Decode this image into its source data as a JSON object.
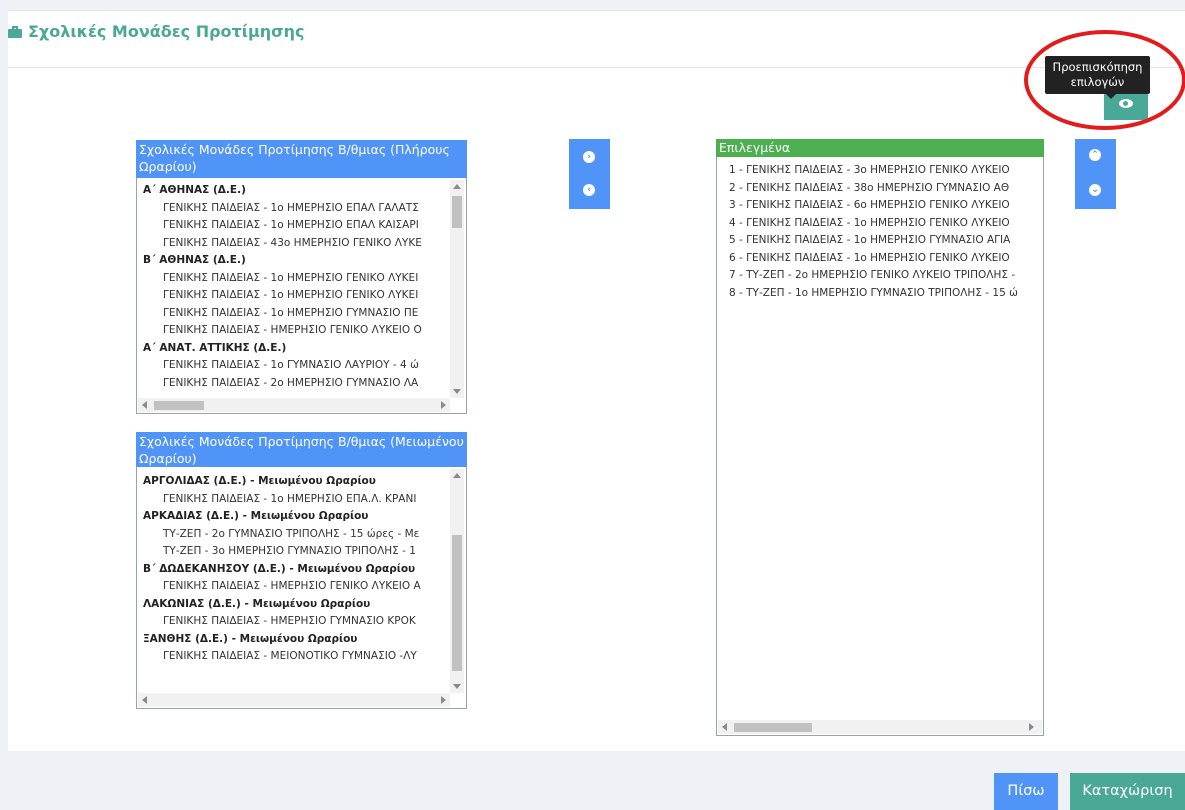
{
  "header": {
    "title": "Σχολικές Μονάδες Προτίμησης"
  },
  "full_time_list": {
    "title": "Σχολικές Μονάδες Προτίμησης Β/θμιας (Πλήρους Ωραρίου)",
    "rows": [
      {
        "type": "group",
        "text": "Α΄ ΑΘΗΝΑΣ (Δ.Ε.)"
      },
      {
        "type": "item",
        "text": "ΓΕΝΙΚΗΣ ΠΑΙΔΕΙΑΣ - 1ο ΗΜΕΡΗΣΙΟ ΕΠΑΛ ΓΑΛΑΤΣ"
      },
      {
        "type": "item",
        "text": "ΓΕΝΙΚΗΣ ΠΑΙΔΕΙΑΣ - 1ο ΗΜΕΡΗΣΙΟ ΕΠΑΛ ΚΑΙΣΑΡΙ"
      },
      {
        "type": "item",
        "text": "ΓΕΝΙΚΗΣ ΠΑΙΔΕΙΑΣ - 43ο ΗΜΕΡΗΣΙΟ ΓΕΝΙΚΟ ΛΥΚΕ"
      },
      {
        "type": "group",
        "text": "Β΄ ΑΘΗΝΑΣ (Δ.Ε.)"
      },
      {
        "type": "item",
        "text": "ΓΕΝΙΚΗΣ ΠΑΙΔΕΙΑΣ - 1ο ΗΜΕΡΗΣΙΟ ΓΕΝΙΚΟ ΛΥΚΕΙ"
      },
      {
        "type": "item",
        "text": "ΓΕΝΙΚΗΣ ΠΑΙΔΕΙΑΣ - 1ο ΗΜΕΡΗΣΙΟ ΓΕΝΙΚΟ ΛΥΚΕΙ"
      },
      {
        "type": "item",
        "text": "ΓΕΝΙΚΗΣ ΠΑΙΔΕΙΑΣ - 1ο ΗΜΕΡΗΣΙΟ ΓΥΜΝΑΣΙΟ ΠΕ"
      },
      {
        "type": "item",
        "text": "ΓΕΝΙΚΗΣ ΠΑΙΔΕΙΑΣ - ΗΜΕΡΗΣΙΟ ΓΕΝΙΚΟ ΛΥΚΕΙΟ Ο"
      },
      {
        "type": "group",
        "text": "Α΄ ΑΝΑΤ. ΑΤΤΙΚΗΣ (Δ.Ε.)"
      },
      {
        "type": "item",
        "text": "ΓΕΝΙΚΗΣ ΠΑΙΔΕΙΑΣ - 1ο ΓΥΜΝΑΣΙΟ ΛΑΥΡΙΟΥ - 4 ώ"
      },
      {
        "type": "item",
        "text": "ΓΕΝΙΚΗΣ ΠΑΙΔΕΙΑΣ - 2ο ΗΜΕΡΗΣΙΟ ΓΥΜΝΑΣΙΟ ΛΑ"
      }
    ]
  },
  "reduced_time_list": {
    "title": "Σχολικές Μονάδες Προτίμησης Β/θμιας (Μειωμένου Ωραρίου)",
    "rows": [
      {
        "type": "group",
        "text": "ΑΡΓΟΛΙΔΑΣ (Δ.Ε.) - Μειωμένου Ωραρίου"
      },
      {
        "type": "item",
        "text": "ΓΕΝΙΚΗΣ ΠΑΙΔΕΙΑΣ - 1ο ΗΜΕΡΗΣΙΟ ΕΠΑ.Λ. ΚΡΑΝΙ"
      },
      {
        "type": "group",
        "text": "ΑΡΚΑΔΙΑΣ (Δ.Ε.) - Μειωμένου Ωραρίου"
      },
      {
        "type": "item",
        "text": "ΤΥ-ΖΕΠ - 2ο ΓΥΜΝΑΣΙΟ ΤΡΙΠΟΛΗΣ - 15 ώρες - Με"
      },
      {
        "type": "item",
        "text": "ΤΥ-ΖΕΠ - 3ο ΗΜΕΡΗΣΙΟ ΓΥΜΝΑΣΙΟ ΤΡΙΠΟΛΗΣ - 1"
      },
      {
        "type": "group",
        "text": "Β΄ ΔΩΔΕΚΑΝΗΣΟΥ (Δ.Ε.) - Μειωμένου Ωραρίου"
      },
      {
        "type": "item",
        "text": "ΓΕΝΙΚΗΣ ΠΑΙΔΕΙΑΣ - ΗΜΕΡΗΣΙΟ ΓΕΝΙΚΟ ΛΥΚΕΙΟ Α"
      },
      {
        "type": "group",
        "text": "ΛΑΚΩΝΙΑΣ (Δ.Ε.) - Μειωμένου Ωραρίου"
      },
      {
        "type": "item",
        "text": "ΓΕΝΙΚΗΣ ΠΑΙΔΕΙΑΣ - ΗΜΕΡΗΣΙΟ ΓΥΜΝΑΣΙΟ ΚΡΟΚ"
      },
      {
        "type": "group",
        "text": "ΞΑΝΘΗΣ (Δ.Ε.) - Μειωμένου Ωραρίου"
      },
      {
        "type": "item",
        "text": "ΓΕΝΙΚΗΣ ΠΑΙΔΕΙΑΣ - ΜΕΙΟΝΟΤΙΚΟ ΓΥΜΝΑΣΙΟ -ΛΥ"
      }
    ]
  },
  "selected_list": {
    "title": "Επιλεγμένα",
    "items": [
      "1 - ΓΕΝΙΚΗΣ ΠΑΙΔΕΙΑΣ - 3ο ΗΜΕΡΗΣΙΟ ΓΕΝΙΚΟ ΛΥΚΕΙΟ",
      "2 - ΓΕΝΙΚΗΣ ΠΑΙΔΕΙΑΣ - 38ο ΗΜΕΡΗΣΙΟ ΓΥΜΝΑΣΙΟ ΑΘ",
      "3 - ΓΕΝΙΚΗΣ ΠΑΙΔΕΙΑΣ - 6ο ΗΜΕΡΗΣΙΟ ΓΕΝΙΚΟ ΛΥΚΕΙΟ",
      "4 - ΓΕΝΙΚΗΣ ΠΑΙΔΕΙΑΣ - 1ο ΗΜΕΡΗΣΙΟ ΓΕΝΙΚΟ ΛΥΚΕΙΟ",
      "5 - ΓΕΝΙΚΗΣ ΠΑΙΔΕΙΑΣ - 1ο ΗΜΕΡΗΣΙΟ ΓΥΜΝΑΣΙΟ ΑΓΙΑ",
      "6 - ΓΕΝΙΚΗΣ ΠΑΙΔΕΙΑΣ - 1ο ΗΜΕΡΗΣΙΟ ΓΕΝΙΚΟ ΛΥΚΕΙΟ",
      "7 - ΤΥ-ΖΕΠ - 2ο ΗΜΕΡΗΣΙΟ ΓΕΝΙΚΟ ΛΥΚΕΙΟ ΤΡΙΠΟΛΗΣ -",
      "8 - ΤΥ-ΖΕΠ - 1ο ΗΜΕΡΗΣΙΟ ΓΥΜΝΑΣΙΟ ΤΡΙΠΟΛΗΣ - 15 ώ"
    ]
  },
  "preview": {
    "tooltip": "Προεπισκόπηση επιλογών"
  },
  "footer": {
    "back_label": "Πίσω",
    "submit_label": "Καταχώριση"
  },
  "colors": {
    "accent_teal": "#4aa896",
    "accent_blue": "#4f94f6",
    "selected_header_green": "#4caf50",
    "annotation_red": "#e31b1b"
  }
}
